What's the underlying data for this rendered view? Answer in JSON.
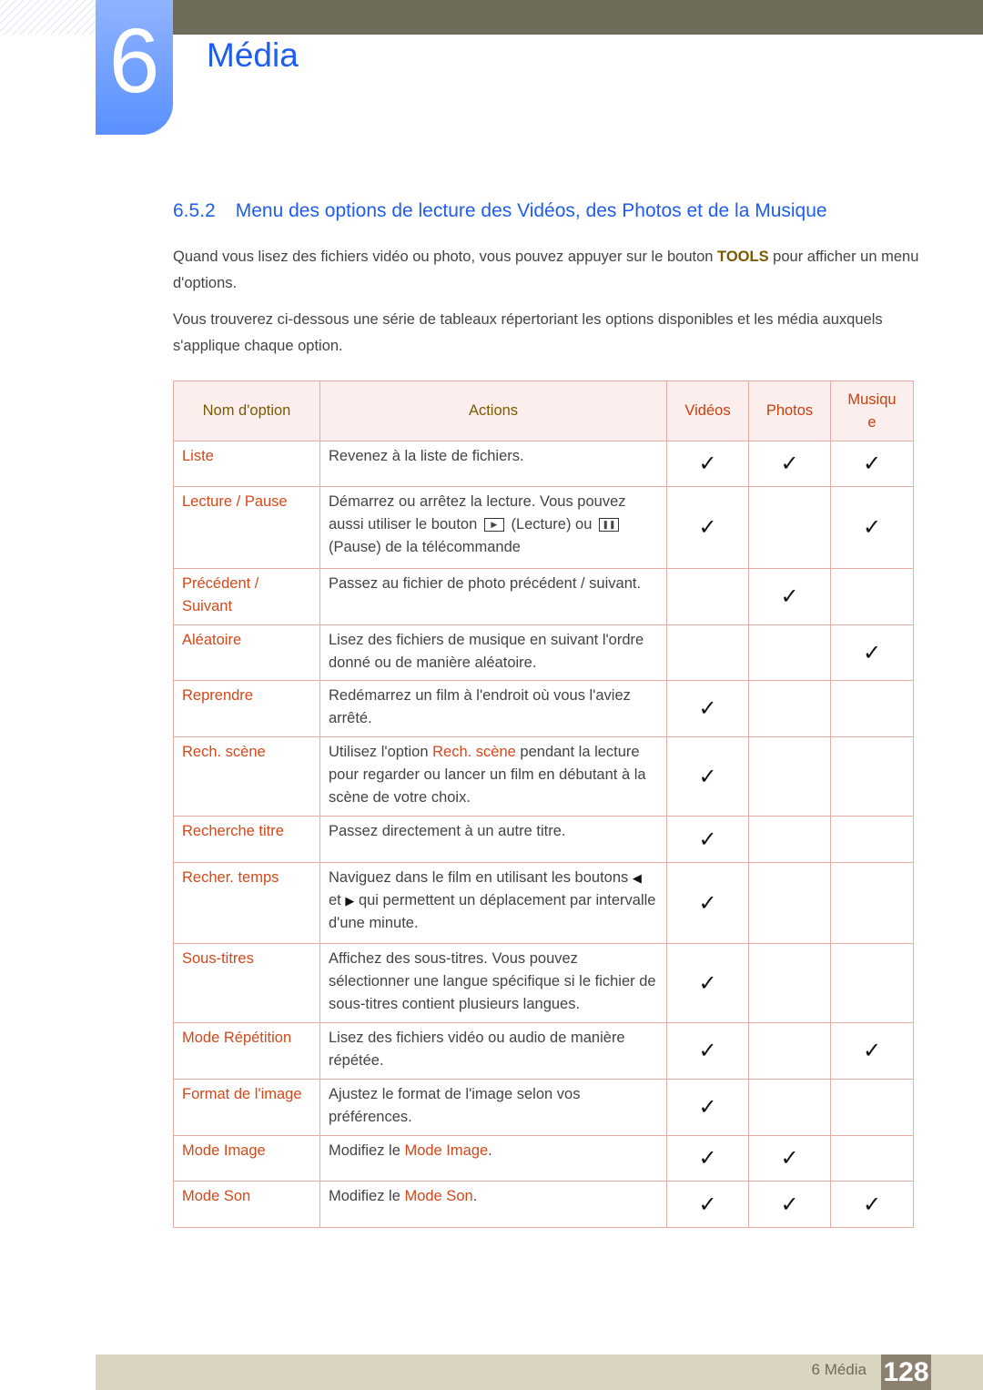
{
  "chapter": {
    "number": "6",
    "title": "Média"
  },
  "section": {
    "number": "6.5.2",
    "title": "Menu des options de lecture des Vidéos, des Photos et de la Musique"
  },
  "intro": [
    [
      {
        "t": "Quand vous lisez des fichiers vidéo ou photo, vous pouvez appuyer sur le bouton "
      },
      {
        "t": "TOOLS",
        "hl": "tools"
      },
      {
        "t": " pour afficher un menu d'options."
      }
    ],
    [
      {
        "t": "Vous trouverez ci-dessous une série de tableaux répertoriant les options disponibles et les média auxquels s'applique chaque option."
      }
    ]
  ],
  "table": {
    "headers": [
      "Nom d'option",
      "Actions",
      "Vidéos",
      "Photos",
      "Musique"
    ],
    "check_symbol": "✓",
    "rows": [
      {
        "name": [
          {
            "t": "Liste",
            "hl": 1
          }
        ],
        "action": [
          {
            "t": "Revenez à la liste de fichiers."
          }
        ],
        "v": true,
        "p": true,
        "m": true,
        "h": 50
      },
      {
        "name": [
          {
            "t": "Lecture",
            "hl": 1
          },
          {
            "t": " / "
          },
          {
            "t": "Pause",
            "hl": 1
          }
        ],
        "action": [
          {
            "t": "Démarrez ou arrêtez la lecture. Vous pouvez aussi utiliser le bouton "
          },
          {
            "icon": "play-button-icon",
            "g": "▶"
          },
          {
            "t": " (Lecture) ou "
          },
          {
            "icon": "pause-button-icon",
            "g": "❚❚"
          },
          {
            "t": " (Pause) de la télécommande"
          }
        ],
        "v": true,
        "p": false,
        "m": true,
        "h": 90
      },
      {
        "name": [
          {
            "t": "Précédent",
            "hl": 1
          },
          {
            "t": " / "
          },
          {
            "t": "Suivant",
            "hl": 1
          }
        ],
        "action": [
          {
            "t": "Passez au fichier de photo précédent / suivant."
          }
        ],
        "v": false,
        "p": true,
        "m": false,
        "h": 62
      },
      {
        "name": [
          {
            "t": "Aléatoire",
            "hl": 1
          }
        ],
        "action": [
          {
            "t": "Lisez des fichiers de musique en suivant l'ordre donné ou de manière aléatoire."
          }
        ],
        "v": false,
        "p": false,
        "m": true,
        "h": 61
      },
      {
        "name": [
          {
            "t": "Reprendre",
            "hl": 1
          }
        ],
        "action": [
          {
            "t": "Redémarrez un film à l'endroit où vous l'aviez arrêté."
          }
        ],
        "v": true,
        "p": false,
        "m": false,
        "h": 62
      },
      {
        "name": [
          {
            "t": "Rech. scène",
            "hl": 1
          }
        ],
        "action": [
          {
            "t": "Utilisez l'option "
          },
          {
            "t": "Rech. scène",
            "hl": 1
          },
          {
            "t": " pendant la lecture pour regarder ou lancer un film en débutant à la scène de votre choix."
          }
        ],
        "v": true,
        "p": false,
        "m": false,
        "h": 87
      },
      {
        "name": [
          {
            "t": "Recherche titre",
            "hl": 1
          }
        ],
        "action": [
          {
            "t": "Passez directement à un autre titre."
          }
        ],
        "v": true,
        "p": false,
        "m": false,
        "h": 51
      },
      {
        "name": [
          {
            "t": "Recher. temps",
            "hl": 1
          }
        ],
        "action": [
          {
            "t": "Naviguez dans le film en utilisant les boutons "
          },
          {
            "arrow": "left-arrow-icon",
            "g": "◀"
          },
          {
            "t": " et "
          },
          {
            "arrow": "right-arrow-icon",
            "g": "▶"
          },
          {
            "t": " qui permettent un déplacement par intervalle d'une minute."
          }
        ],
        "v": true,
        "p": false,
        "m": false,
        "h": 89
      },
      {
        "name": [
          {
            "t": "Sous-titres",
            "hl": 1
          }
        ],
        "action": [
          {
            "t": "Affichez des sous-titres. Vous pouvez sélectionner une langue spécifique si le fichier de sous-titres contient plusieurs langues."
          }
        ],
        "v": true,
        "p": false,
        "m": false,
        "h": 87
      },
      {
        "name": [
          {
            "t": "Mode Répétition",
            "hl": 1
          }
        ],
        "action": [
          {
            "t": "Lisez des fichiers vidéo ou audio de manière répétée."
          }
        ],
        "v": true,
        "p": false,
        "m": true,
        "h": 62
      },
      {
        "name": [
          {
            "t": "Format de l'image",
            "hl": 1
          }
        ],
        "action": [
          {
            "t": "Ajustez le format de l'image selon vos préférences."
          }
        ],
        "v": true,
        "p": false,
        "m": false,
        "h": 62
      },
      {
        "name": [
          {
            "t": "Mode Image",
            "hl": 1
          }
        ],
        "action": [
          {
            "t": "Modifiez le "
          },
          {
            "t": "Mode Image",
            "hl": 1
          },
          {
            "t": "."
          }
        ],
        "v": true,
        "p": true,
        "m": false,
        "h": 50
      },
      {
        "name": [
          {
            "t": "Mode Son",
            "hl": 1
          }
        ],
        "action": [
          {
            "t": "Modifiez le "
          },
          {
            "t": "Mode Son",
            "hl": 1
          },
          {
            "t": "."
          }
        ],
        "v": true,
        "p": true,
        "m": true,
        "h": 51
      }
    ]
  },
  "footer": {
    "label": "6 Média",
    "page": "128"
  },
  "colors": {
    "blue": "#1f5cf0",
    "highlight": "#d4481a",
    "tools": "#7a5a00"
  }
}
